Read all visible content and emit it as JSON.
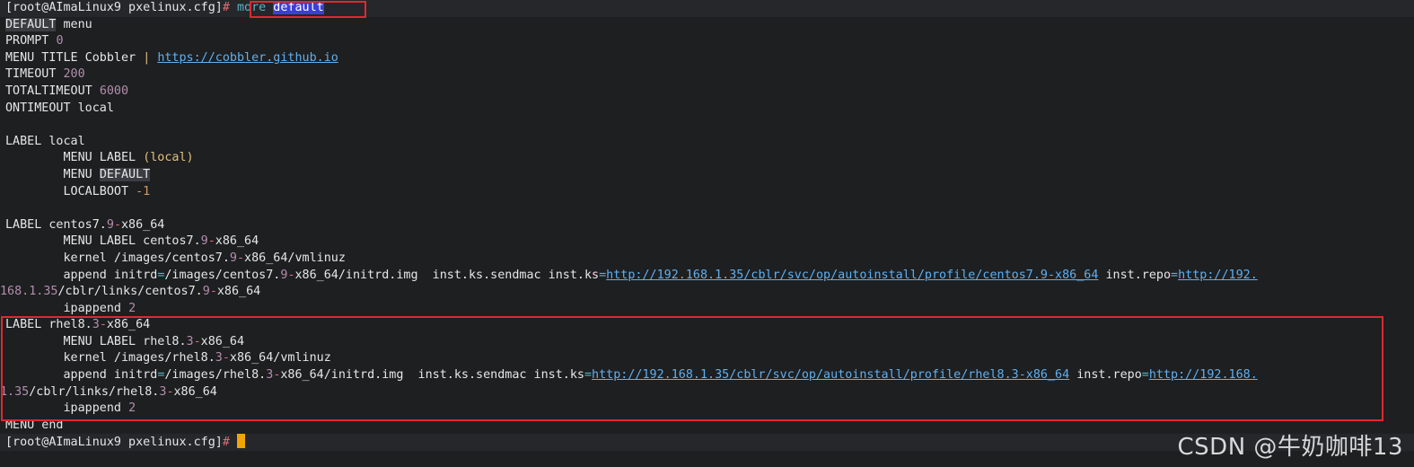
{
  "terminal": {
    "prompt": "[root@AImaLinux9 pxelinux.cfg]",
    "prompt_hash": "#",
    "command_word": "more",
    "command_arg": "default",
    "lines": {
      "l1_kw": "DEFAULT",
      "l1_rest": " menu",
      "l2_kw": "PROMPT ",
      "l2_val": "0",
      "l3_kw": "MENU TITLE Cobbler ",
      "l3_bar": "|",
      "l3_link": "https://cobbler.github.io",
      "l4_kw": "TIMEOUT ",
      "l4_val": "200",
      "l5_kw": "TOTALTIMEOUT ",
      "l5_val": "6000",
      "l6": "ONTIMEOUT local",
      "l8": "LABEL local",
      "l9_kw": "        MENU LABEL ",
      "l9_val": "(local)",
      "l10_kw": "        MENU ",
      "l10_val": "DEFAULT",
      "l11_kw": "        LOCALBOOT ",
      "l11_val": "-1",
      "c_label_a": "LABEL centos7.",
      "c_label_num": "9",
      "c_label_dash": "-",
      "c_label_b": "x86_64",
      "c_menu_a": "        MENU LABEL centos7.",
      "c_menu_num": "9",
      "c_menu_dash": "-",
      "c_menu_b": "x86_64",
      "c_kernel_a": "        kernel /images/centos7.",
      "c_kernel_num": "9",
      "c_kernel_dash": "-",
      "c_kernel_b": "x86_64/vmlinuz",
      "c_append_a": "        append initrd",
      "c_append_eq1": "=",
      "c_append_b": "/images/centos7.",
      "c_append_num": "9",
      "c_append_dash": "-",
      "c_append_c": "x86_64/initrd.img  inst.ks.sendmac inst.ks",
      "c_append_eq2": "=",
      "c_append_link1": "http://192.168.1.35/cblr/svc/op/autoinstall/profile/centos7.9-x86_64",
      "c_append_d": " inst.repo",
      "c_append_eq3": "=",
      "c_append_link2": "http://192.",
      "c_cont_num": "168.1.35",
      "c_cont_a": "/cblr/links/centos7.",
      "c_cont_num2": "9",
      "c_cont_dash": "-",
      "c_cont_b": "x86_64",
      "c_ipappend_kw": "        ipappend ",
      "c_ipappend_val": "2",
      "r_label_a": "LABEL rhel8.",
      "r_label_num": "3",
      "r_label_dash": "-",
      "r_label_b": "x86_64",
      "r_menu_a": "        MENU LABEL rhel8.",
      "r_menu_num": "3",
      "r_menu_dash": "-",
      "r_menu_b": "x86_64",
      "r_kernel_a": "        kernel /images/rhel8.",
      "r_kernel_num": "3",
      "r_kernel_dash": "-",
      "r_kernel_b": "x86_64/vmlinuz",
      "r_append_a": "        append initrd",
      "r_append_eq1": "=",
      "r_append_b": "/images/rhel8.",
      "r_append_num": "3",
      "r_append_dash": "-",
      "r_append_c": "x86_64/initrd.img  inst.ks.sendmac inst.ks",
      "r_append_eq2": "=",
      "r_append_link1": "http://192.168.1.35/cblr/svc/op/autoinstall/profile/rhel8.3-x86_64",
      "r_append_d": " inst.repo",
      "r_append_eq3": "=",
      "r_append_link2": "http://192.168.",
      "r_cont_num": "1.35",
      "r_cont_a": "/cblr/links/rhel8.",
      "r_cont_num2": "3",
      "r_cont_dash": "-",
      "r_cont_b": "x86_64",
      "r_ipappend_kw": "        ipappend ",
      "r_ipappend_val": "2",
      "end": "MENU end"
    }
  },
  "watermark": "CSDN @牛奶咖啡13",
  "colors": {
    "background": "#1d1f21",
    "highlight_box": "#e0282e",
    "cursor": "#f0a500",
    "link": "#61afef"
  }
}
